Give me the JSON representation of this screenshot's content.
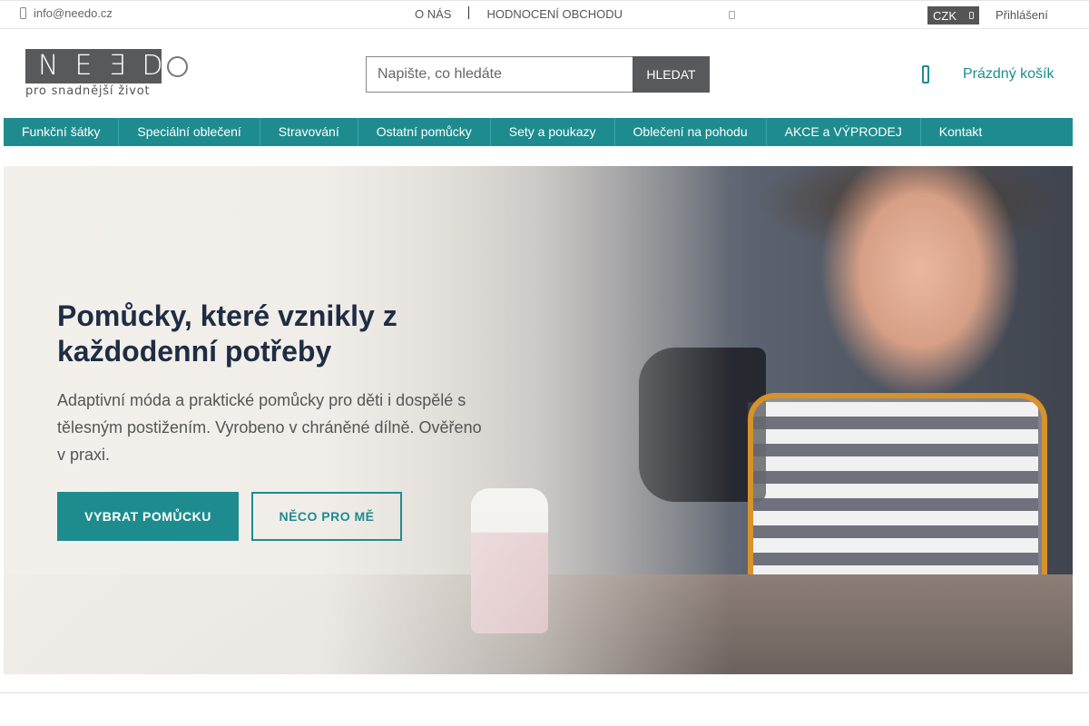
{
  "topbar": {
    "email": "info@needo.cz",
    "email_icon": "mail-icon",
    "links": [
      "O NÁS",
      "HODNOCENÍ OBCHODU"
    ],
    "currency": "CZK",
    "login": "Přihlášení"
  },
  "header": {
    "logo_text": "NEƎDO",
    "logo_tagline": "pro snadnější život",
    "search_placeholder": "Napište, co hledáte",
    "search_button": "HLEDAT",
    "cart_icon": "cart-icon",
    "cart_label": "Prázdný košík"
  },
  "nav": {
    "items": [
      "Funkční šátky",
      "Speciální oblečení",
      "Stravování",
      "Ostatní pomůcky",
      "Sety a poukazy",
      "Oblečení na pohodu",
      "AKCE a VÝPRODEJ",
      "Kontakt"
    ]
  },
  "hero": {
    "title": "Pomůcky, které vznikly z každodenní potřeby",
    "text": "Adaptivní móda a praktické pomůcky pro děti i dospělé s tělesným postižením. Vyrobeno v chráněné dílně. Ověřeno v praxi.",
    "primary_button": "VYBRAT POMŮCKU",
    "secondary_button": "NĚCO PRO MĚ"
  },
  "colors": {
    "accent": "#1e8c8f",
    "dark": "#58595b",
    "heading": "#1e2d43"
  }
}
